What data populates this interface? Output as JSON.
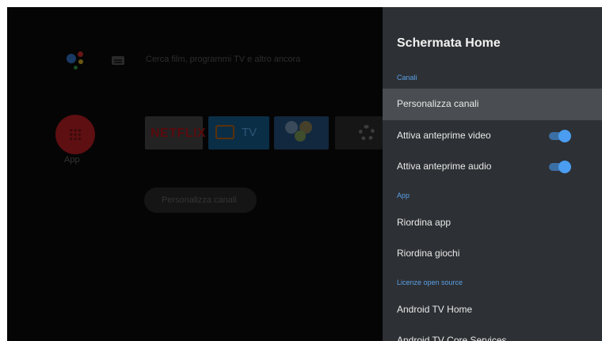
{
  "home": {
    "search_placeholder": "Cerca film, programmi TV e altro ancora",
    "apps_label": "App",
    "netflix_label": "NETFLIX",
    "tv_label": "TV",
    "customize_button_label": "Personalizza canali"
  },
  "panel": {
    "title": "Schermata Home",
    "sections": {
      "channels": "Canali",
      "apps": "App",
      "licenses": "Licenze open source"
    },
    "items": {
      "customize_channels": "Personalizza canali",
      "video_previews": "Attiva anteprime video",
      "audio_previews": "Attiva anteprime audio",
      "reorder_apps": "Riordina app",
      "reorder_games": "Riordina giochi",
      "android_tv_home": "Android TV Home",
      "android_tv_core_services": "Android TV Core Services"
    },
    "toggles": {
      "video_previews_on": true,
      "audio_previews_on": true
    }
  },
  "colors": {
    "panel_bg": "#2d3034",
    "selected_row_bg": "#4a4d51",
    "section_accent": "#5aa0e6",
    "toggle_on": "#4a9df0"
  }
}
